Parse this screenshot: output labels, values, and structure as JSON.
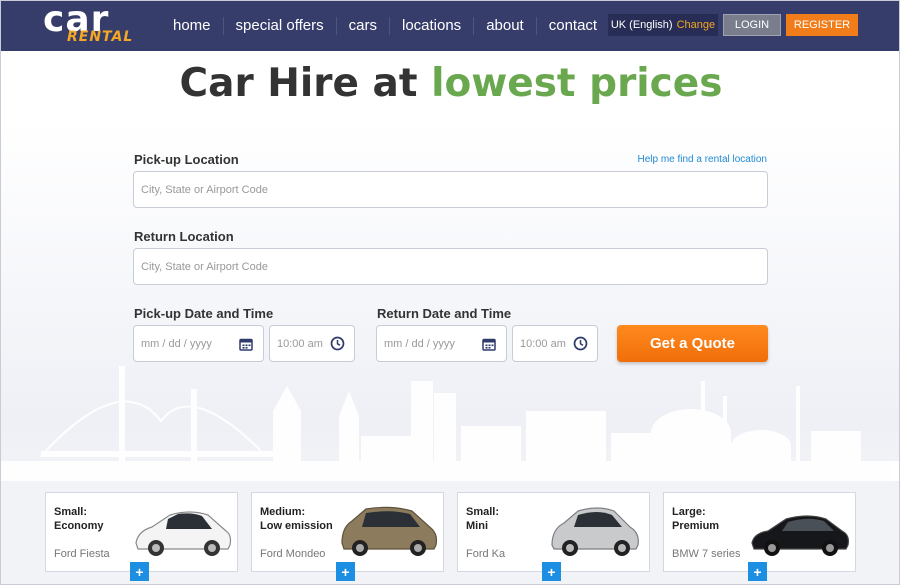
{
  "header": {
    "logo_word": "car",
    "logo_sub": "RENTAL",
    "nav": [
      "home",
      "special offers",
      "cars",
      "locations",
      "about",
      "contact"
    ],
    "language": "UK (English)",
    "change_label": "Change",
    "login_label": "LOGIN",
    "register_label": "REGISTER"
  },
  "headline": {
    "part1": "Car Hire at",
    "part2": "lowest prices"
  },
  "form": {
    "pickup_label": "Pick-up Location",
    "help_link": "Help me find a rental location",
    "pickup_placeholder": "City, State or Airport Code",
    "return_label": "Return Location",
    "return_placeholder": "City, State or Airport Code",
    "pickup_dt_label": "Pick-up Date and Time",
    "return_dt_label": "Return Date and Time",
    "pickup_date_placeholder": "mm / dd / yyyy",
    "pickup_time": "10:00 am",
    "return_date_placeholder": "mm / dd / yyyy",
    "return_time": "10:00 am",
    "quote_label": "Get a Quote"
  },
  "cards": [
    {
      "line1": "Small:",
      "line2": "Economy",
      "model": "Ford Fiesta",
      "color": "white-car-icon"
    },
    {
      "line1": "Medium:",
      "line2": "Low emission",
      "model": "Ford Mondeo",
      "color": "bronze-car-icon"
    },
    {
      "line1": "Small:",
      "line2": "Mini",
      "model": "Ford Ka",
      "color": "silver-car-icon"
    },
    {
      "line1": "Large:",
      "line2": "Premium",
      "model": "BMW 7 series",
      "color": "black-car-icon"
    }
  ],
  "colors": {
    "header_bg": "#363d6b",
    "accent_orange": "#f07d1a",
    "headline_green": "#6aa84f",
    "link_blue": "#1f8ad6",
    "plus_blue": "#1d8fe3"
  }
}
